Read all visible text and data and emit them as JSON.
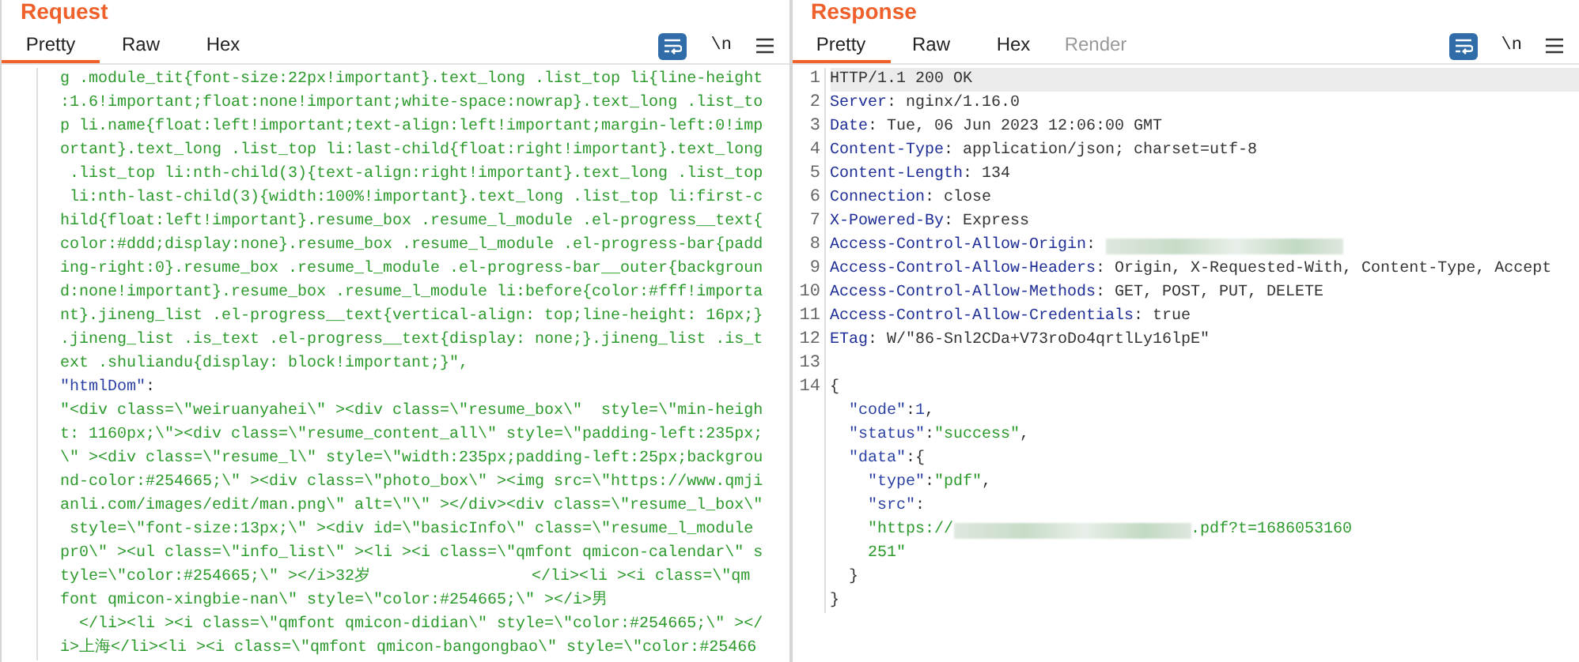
{
  "panels": [
    {
      "title": "Request",
      "tabs": [
        {
          "label": "Pretty",
          "selected": true,
          "disabled": false
        },
        {
          "label": "Raw",
          "selected": false,
          "disabled": false
        },
        {
          "label": "Hex",
          "selected": false,
          "disabled": false
        }
      ],
      "wrap_on": true,
      "newline_label": "\\n",
      "lines": [
        {
          "segments": [
            {
              "kind": "string",
              "text": "g .module_tit{font-size:22px!important}.text_long .list_top li{line-height"
            }
          ]
        },
        {
          "segments": [
            {
              "kind": "string",
              "text": ":1.6!important;float:none!important;white-space:nowrap}.text_long .list_to"
            }
          ]
        },
        {
          "segments": [
            {
              "kind": "string",
              "text": "p li.name{float:left!important;text-align:left!important;margin-left:0!imp"
            }
          ]
        },
        {
          "segments": [
            {
              "kind": "string",
              "text": "ortant}.text_long .list_top li:last-child{float:right!important}.text_long"
            }
          ]
        },
        {
          "segments": [
            {
              "kind": "string",
              "text": " .list_top li:nth-child(3){text-align:right!important}.text_long .list_top"
            }
          ]
        },
        {
          "segments": [
            {
              "kind": "string",
              "text": " li:nth-last-child(3){width:100%!important}.text_long .list_top li:first-c"
            }
          ]
        },
        {
          "segments": [
            {
              "kind": "string",
              "text": "hild{float:left!important}.resume_box .resume_l_module .el-progress__text{"
            }
          ]
        },
        {
          "segments": [
            {
              "kind": "string",
              "text": "color:#ddd;display:none}.resume_box .resume_l_module .el-progress-bar{padd"
            }
          ]
        },
        {
          "segments": [
            {
              "kind": "string",
              "text": "ing-right:0}.resume_box .resume_l_module .el-progress-bar__outer{backgroun"
            }
          ]
        },
        {
          "segments": [
            {
              "kind": "string",
              "text": "d:none!important}.resume_box .resume_l_module li:before{color:#fff!importa"
            }
          ]
        },
        {
          "segments": [
            {
              "kind": "string",
              "text": "nt}.jineng_list .el-progress__text{vertical-align: top;line-height: 16px;}"
            }
          ]
        },
        {
          "segments": [
            {
              "kind": "string",
              "text": ".jineng_list .is_text .el-progress__text{display: none;}.jineng_list .is_t"
            }
          ]
        },
        {
          "segments": [
            {
              "kind": "string",
              "text": "ext .shuliandu{display: block!important;}\","
            }
          ]
        },
        {
          "segments": [
            {
              "kind": "json-key",
              "text": "\"htmlDom\""
            },
            {
              "kind": "plain",
              "text": ":"
            }
          ]
        },
        {
          "segments": [
            {
              "kind": "string",
              "text": "\"<div class=\\\"weiruanyahei\\\" ><div class=\\\"resume_box\\\"  style=\\\"min-heigh"
            }
          ]
        },
        {
          "segments": [
            {
              "kind": "string",
              "text": "t: 1160px;\\\"><div class=\\\"resume_content_all\\\" style=\\\"padding-left:235px;"
            }
          ]
        },
        {
          "segments": [
            {
              "kind": "string",
              "text": "\\\" ><div class=\\\"resume_l\\\" style=\\\"width:235px;padding-left:25px;backgrou"
            }
          ]
        },
        {
          "segments": [
            {
              "kind": "string",
              "text": "nd-color:#254665;\\\" ><div class=\\\"photo_box\\\" ><img src=\\\"https://www.qmji"
            }
          ]
        },
        {
          "segments": [
            {
              "kind": "string",
              "text": "anli.com/images/edit/man.png\\\" alt=\\\"\\\" ></div><div class=\\\"resume_l_box\\\""
            }
          ]
        },
        {
          "segments": [
            {
              "kind": "string",
              "text": " style=\\\"font-size:13px;\\\" ><div id=\\\"basicInfo\\\" class=\\\"resume_l_module"
            }
          ]
        },
        {
          "segments": [
            {
              "kind": "string",
              "text": "pr0\\\" ><ul class=\\\"info_list\\\" ><li ><i class=\\\"qmfont qmicon-calendar\\\" s"
            }
          ]
        },
        {
          "segments": [
            {
              "kind": "string",
              "text": "tyle=\\\"color:#254665;\\\" ></i>32岁                 </li><li ><i class=\\\"qm"
            }
          ]
        },
        {
          "segments": [
            {
              "kind": "string",
              "text": "font qmicon-xingbie-nan\\\" style=\\\"color:#254665;\\\" ></i>男"
            }
          ]
        },
        {
          "segments": [
            {
              "kind": "string",
              "text": "  </li><li ><i class=\\\"qmfont qmicon-didian\\\" style=\\\"color:#254665;\\\" ></"
            }
          ]
        },
        {
          "segments": [
            {
              "kind": "string",
              "text": "i>上海</li><li ><i class=\\\"qmfont qmicon-bangongbao\\\" style=\\\"color:#25466"
            }
          ]
        }
      ]
    },
    {
      "title": "Response",
      "tabs": [
        {
          "label": "Pretty",
          "selected": true,
          "disabled": false
        },
        {
          "label": "Raw",
          "selected": false,
          "disabled": false
        },
        {
          "label": "Hex",
          "selected": false,
          "disabled": false
        },
        {
          "label": "Render",
          "selected": false,
          "disabled": true
        }
      ],
      "wrap_on": true,
      "newline_label": "\\n",
      "lines": [
        {
          "number": "1",
          "highlighted": true,
          "segments": [
            {
              "kind": "plain",
              "text": "HTTP/1.1 200 OK"
            }
          ]
        },
        {
          "number": "2",
          "highlighted": false,
          "segments": [
            {
              "kind": "header-key",
              "text": "Server"
            },
            {
              "kind": "plain",
              "text": ": nginx/1.16.0"
            }
          ]
        },
        {
          "number": "3",
          "highlighted": false,
          "segments": [
            {
              "kind": "header-key",
              "text": "Date"
            },
            {
              "kind": "plain",
              "text": ": Tue, 06 Jun 2023 12:06:00 GMT"
            }
          ]
        },
        {
          "number": "4",
          "highlighted": false,
          "segments": [
            {
              "kind": "header-key",
              "text": "Content-Type"
            },
            {
              "kind": "plain",
              "text": ": application/json; charset=utf-8"
            }
          ]
        },
        {
          "number": "5",
          "highlighted": false,
          "segments": [
            {
              "kind": "header-key",
              "text": "Content-Length"
            },
            {
              "kind": "plain",
              "text": ": 134"
            }
          ]
        },
        {
          "number": "6",
          "highlighted": false,
          "segments": [
            {
              "kind": "header-key",
              "text": "Connection"
            },
            {
              "kind": "plain",
              "text": ": close"
            }
          ]
        },
        {
          "number": "7",
          "highlighted": false,
          "segments": [
            {
              "kind": "header-key",
              "text": "X-Powered-By"
            },
            {
              "kind": "plain",
              "text": ": Express"
            }
          ]
        },
        {
          "number": "8",
          "highlighted": false,
          "segments": [
            {
              "kind": "header-key",
              "text": "Access-Control-Allow-Origin"
            },
            {
              "kind": "plain",
              "text": ": "
            },
            {
              "kind": "redacted"
            }
          ]
        },
        {
          "number": "9",
          "highlighted": false,
          "segments": [
            {
              "kind": "header-key",
              "text": "Access-Control-Allow-Headers"
            },
            {
              "kind": "plain",
              "text": ": Origin, X-Requested-With, Content-Type, Accept"
            }
          ]
        },
        {
          "number": "10",
          "highlighted": false,
          "segments": [
            {
              "kind": "header-key",
              "text": "Access-Control-Allow-Methods"
            },
            {
              "kind": "plain",
              "text": ": GET, POST, PUT, DELETE"
            }
          ]
        },
        {
          "number": "11",
          "highlighted": false,
          "segments": [
            {
              "kind": "header-key",
              "text": "Access-Control-Allow-Credentials"
            },
            {
              "kind": "plain",
              "text": ": true"
            }
          ]
        },
        {
          "number": "12",
          "highlighted": false,
          "segments": [
            {
              "kind": "header-key",
              "text": "ETag"
            },
            {
              "kind": "plain",
              "text": ": W/\"86-Snl2CDa+V73roDo4qrtlLy16lpE\""
            }
          ]
        },
        {
          "number": "13",
          "highlighted": false
        },
        {
          "number": "14",
          "highlighted": false,
          "segments": [
            {
              "kind": "plain",
              "text": "{"
            }
          ]
        },
        {
          "highlighted": false,
          "segments": [
            {
              "kind": "json-key",
              "text": "  \"code\""
            },
            {
              "kind": "plain",
              "text": ":"
            },
            {
              "kind": "number",
              "text": "1"
            },
            {
              "kind": "plain",
              "text": ","
            }
          ]
        },
        {
          "highlighted": false,
          "segments": [
            {
              "kind": "json-key",
              "text": "  \"status\""
            },
            {
              "kind": "plain",
              "text": ":"
            },
            {
              "kind": "string",
              "text": "\"success\""
            },
            {
              "kind": "plain",
              "text": ","
            }
          ]
        },
        {
          "highlighted": false,
          "segments": [
            {
              "kind": "json-key",
              "text": "  \"data\""
            },
            {
              "kind": "plain",
              "text": ":{"
            }
          ]
        },
        {
          "highlighted": false,
          "segments": [
            {
              "kind": "json-key",
              "text": "    \"type\""
            },
            {
              "kind": "plain",
              "text": ":"
            },
            {
              "kind": "string",
              "text": "\"pdf\""
            },
            {
              "kind": "plain",
              "text": ","
            }
          ]
        },
        {
          "highlighted": false,
          "segments": [
            {
              "kind": "json-key",
              "text": "    \"src\""
            },
            {
              "kind": "plain",
              "text": ":"
            }
          ]
        },
        {
          "highlighted": false,
          "segments": [
            {
              "kind": "string",
              "text": "    \"https://"
            },
            {
              "kind": "redacted"
            },
            {
              "kind": "string",
              "text": ".pdf?t=1686053160"
            }
          ]
        },
        {
          "highlighted": false,
          "segments": [
            {
              "kind": "string",
              "text": "    251\""
            }
          ]
        },
        {
          "highlighted": false,
          "segments": [
            {
              "kind": "plain",
              "text": "  }"
            }
          ]
        },
        {
          "highlighted": false,
          "segments": [
            {
              "kind": "plain",
              "text": "}"
            }
          ]
        }
      ]
    }
  ]
}
